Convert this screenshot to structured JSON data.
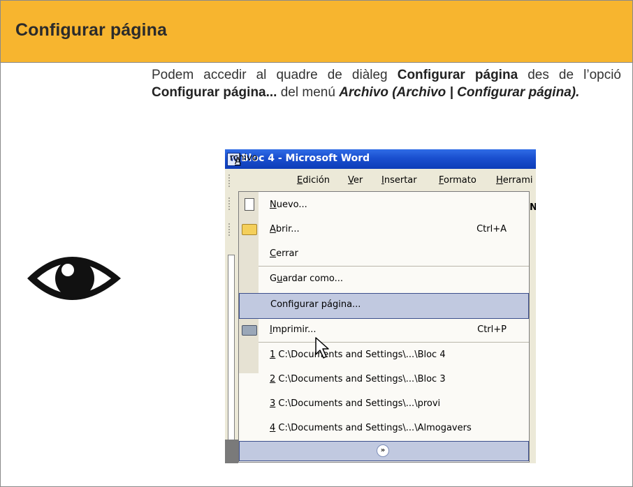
{
  "header": {
    "title": "Configurar página"
  },
  "intro": {
    "t1": "Podem accedir al quadre de diàleg ",
    "b1": "Configurar página",
    "t2": " des de l’opció ",
    "b2": "Configurar página...",
    "t3": " del menú ",
    "bi1": "Archivo (Archivo | Configurar página)."
  },
  "word": {
    "title": "Bloc 4 - Microsoft Word",
    "menu": [
      "Archivo",
      "Edición",
      "Ver",
      "Insertar",
      "Formato",
      "Herrami"
    ],
    "items": {
      "nuevo": "Nuevo...",
      "abrir": "Abrir...",
      "abrir_sc": "Ctrl+A",
      "cerrar": "Cerrar",
      "guardar": "Guardar como...",
      "configurar": "Configurar página...",
      "imprimir": "Imprimir...",
      "imprimir_sc": "Ctrl+P",
      "r1": "1 C:\\Documents and Settings\\...\\Bloc 4",
      "r2": "2 C:\\Documents and Settings\\...\\Bloc 3",
      "r3": "3 C:\\Documents and Settings\\...\\provi",
      "r4": "4 C:\\Documents and Settings\\...\\Almogavers"
    },
    "icons": [
      "word-app-icon",
      "new-document-icon",
      "open-folder-icon",
      "printer-icon",
      "expand-chevron-icon",
      "mouse-cursor-icon"
    ]
  },
  "icons": [
    "eye-icon"
  ],
  "colors": {
    "header_bg": "#f7b52f",
    "highlight": "#c1c9e0",
    "titlebar": "#1a4fcf"
  }
}
